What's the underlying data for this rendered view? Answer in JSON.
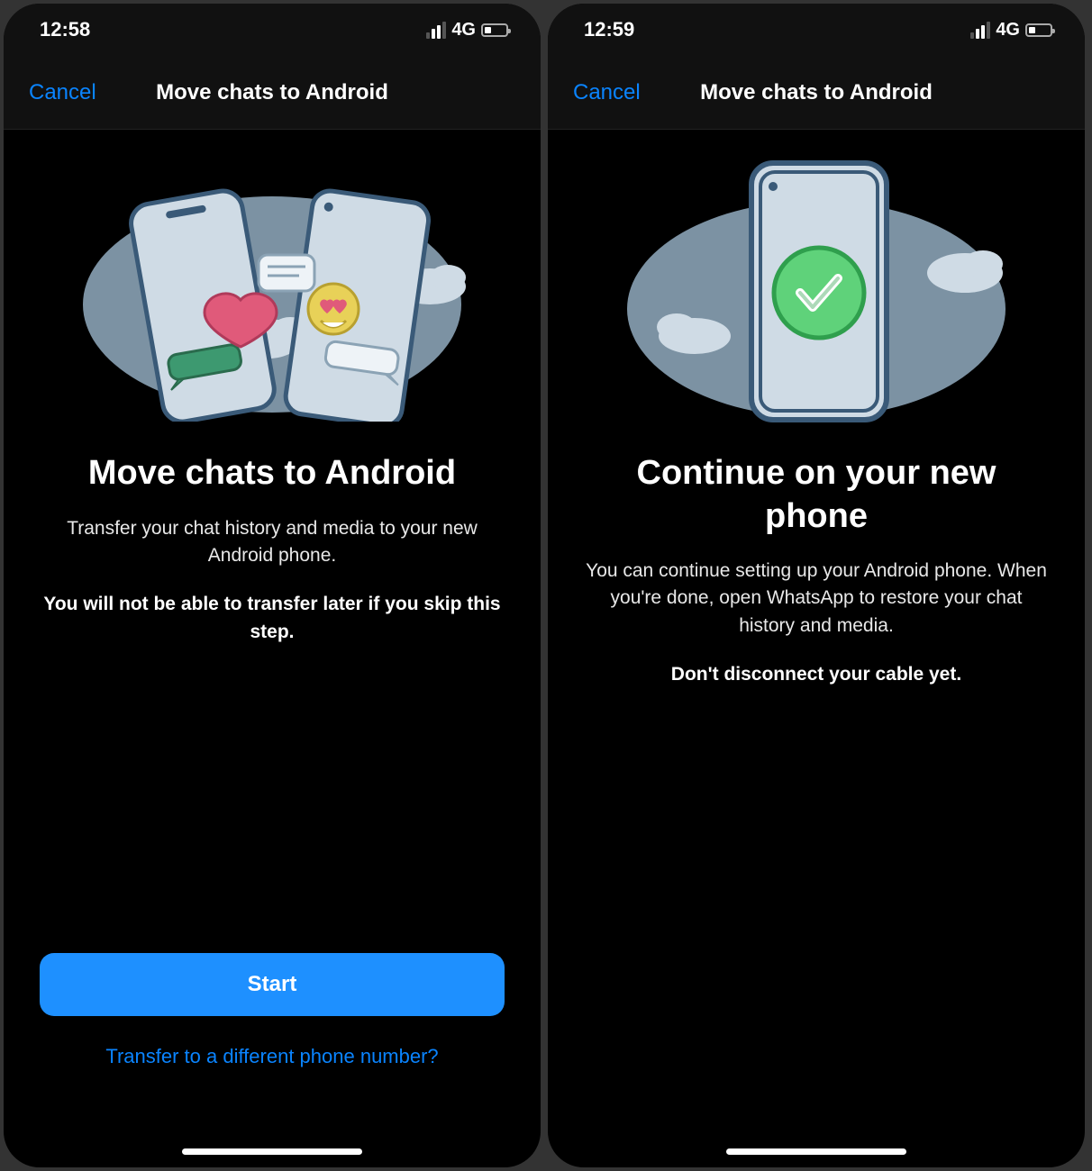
{
  "left": {
    "status": {
      "time": "12:58",
      "network": "4G"
    },
    "nav": {
      "cancel": "Cancel",
      "title": "Move chats to Android"
    },
    "heading": "Move chats to Android",
    "body": "Transfer your chat history and media to your new Android phone.",
    "warning": "You will not be able to transfer later if you skip this step.",
    "primary_button": "Start",
    "secondary_link": "Transfer to a different phone number?"
  },
  "right": {
    "status": {
      "time": "12:59",
      "network": "4G"
    },
    "nav": {
      "cancel": "Cancel",
      "title": "Move chats to Android"
    },
    "heading": "Continue on your new phone",
    "body": "You can continue setting up your Android phone. When you're done, open WhatsApp to restore your chat history and media.",
    "warning": "Don't disconnect your cable yet."
  }
}
